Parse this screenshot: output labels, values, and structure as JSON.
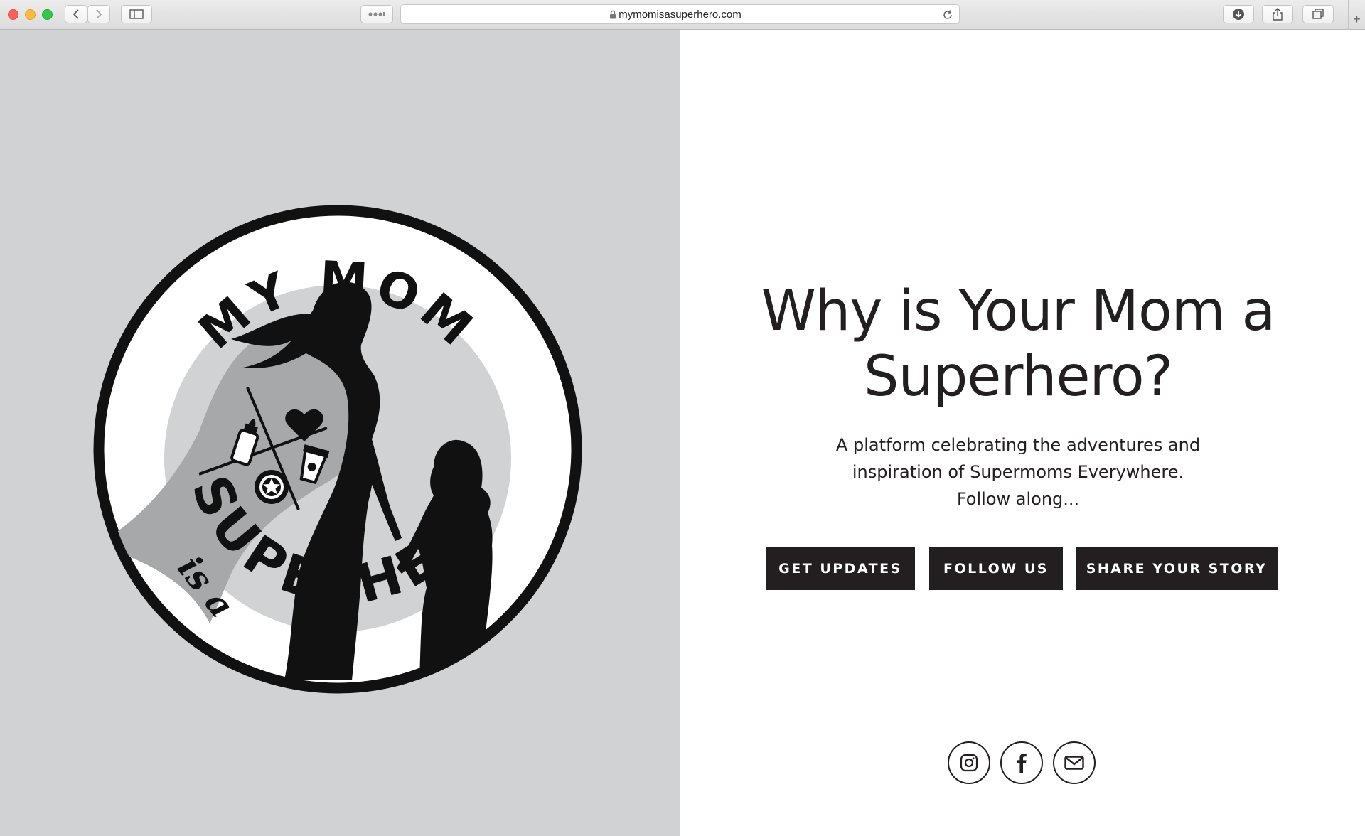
{
  "browser": {
    "url": "mymomisasuperhero.com",
    "new_tab_label": "+",
    "icons": {
      "back": "chevron-left-icon",
      "forward": "chevron-right-icon",
      "sidebar": "sidebar-icon",
      "reader": "reader-icon",
      "lock": "lock-icon",
      "reload": "reload-icon",
      "downloads": "download-icon",
      "share": "share-icon",
      "tabs": "tab-overview-icon"
    }
  },
  "logo": {
    "top_text": "MY MOM",
    "script_text": "is a",
    "bottom_text": "SUPERHERO"
  },
  "hero": {
    "headline_line1": "Why is Your Mom a",
    "headline_line2": "Superhero?",
    "tagline_line1": "A platform celebrating the adventures and",
    "tagline_line2": "inspiration of Supermoms Everywhere.",
    "tagline_line3": "Follow along..."
  },
  "buttons": {
    "get_updates": "GET UPDATES",
    "follow_us": "FOLLOW US",
    "share_story": "SHARE YOUR STORY"
  },
  "social": {
    "instagram": "instagram-icon",
    "facebook": "facebook-icon",
    "email": "email-icon"
  },
  "colors": {
    "left_background": "#d1d2d4",
    "button_background": "#231f20",
    "text": "#231f20",
    "cape_gray": "#a7a8aa"
  }
}
